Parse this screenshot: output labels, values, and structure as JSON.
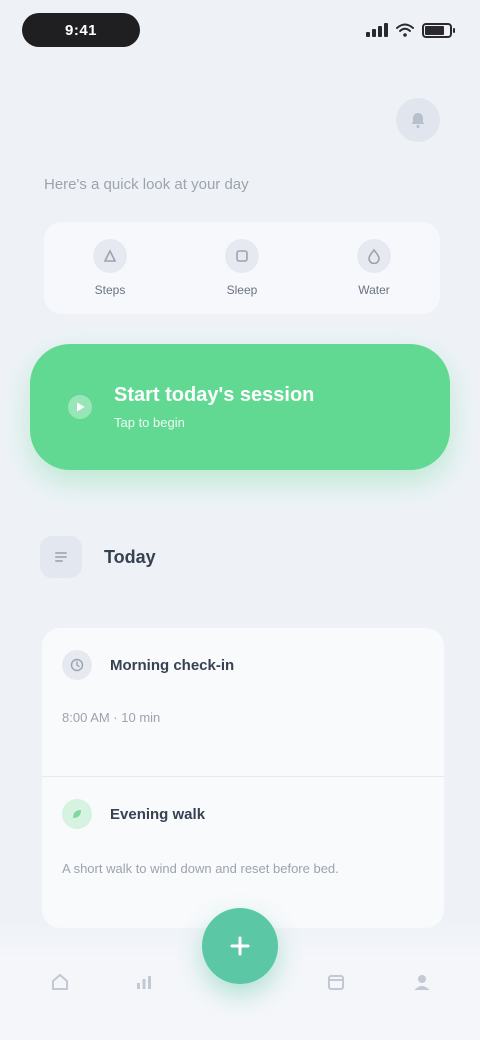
{
  "status_bar": {
    "time": "9:41",
    "icons": [
      "signal-icon",
      "wifi-icon",
      "battery-icon"
    ]
  },
  "header": {
    "action_icon": "bell-icon"
  },
  "subtitle": "Here's a quick look at your day",
  "stats": [
    {
      "icon": "steps-icon",
      "label": "Steps"
    },
    {
      "icon": "sleep-icon",
      "label": "Sleep"
    },
    {
      "icon": "water-icon",
      "label": "Water"
    }
  ],
  "cta": {
    "icon": "play-icon",
    "title": "Start today's session",
    "subtitle": "Tap to begin"
  },
  "section": {
    "icon": "list-icon",
    "title": "Today"
  },
  "list": [
    {
      "icon": "clock-icon",
      "title": "Morning check-in",
      "meta": "8:00 AM · 10 min"
    },
    {
      "icon": "leaf-icon",
      "title": "Evening walk",
      "desc": "A short walk to wind down and reset before bed."
    }
  ],
  "colors": {
    "background": "#eef2f7",
    "accent_green": "#62d992",
    "nav_accent": "#5cc7a5",
    "status_pill": "#1f1f22"
  },
  "bottom_nav": {
    "items": [
      "home-icon",
      "chart-icon",
      "plus-icon",
      "calendar-icon",
      "profile-icon"
    ]
  }
}
